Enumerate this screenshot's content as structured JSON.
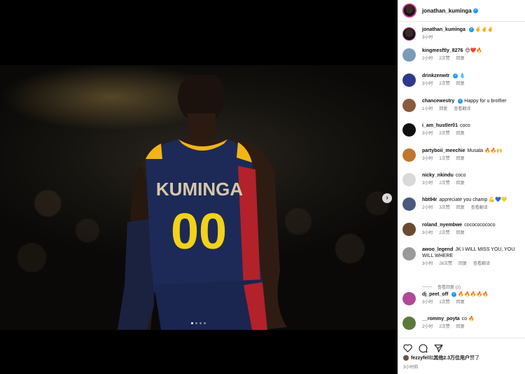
{
  "post": {
    "author": "jonathan_kuminga",
    "image_dots": 4,
    "active_dot": 0,
    "jersey": {
      "name": "KUMINGA",
      "number": "00"
    }
  },
  "caption": {
    "user": "jonathan_kuminga",
    "text": "✌️✌️✌️",
    "time": "3小时",
    "verified": true
  },
  "comments": [
    {
      "user": "kingmesftly_8276",
      "text": "😍❤️🔥",
      "time": "2小时",
      "likes": "2次赞",
      "reply": "回复",
      "translate": "",
      "verified": false,
      "avatar": "#7b9ab8"
    },
    {
      "user": "drinkzenwtr",
      "text": "💧",
      "time": "3小时",
      "likes": "2次赞",
      "reply": "回复",
      "translate": "",
      "verified": true,
      "avatar": "#2d3a8c"
    },
    {
      "user": "chancewestry",
      "text": "Happy for u brother",
      "time": "1小时",
      "likes": "",
      "reply": "回复",
      "translate": "查看翻译",
      "verified": true,
      "avatar": "#8a5a3c"
    },
    {
      "user": "i_am_hustler01",
      "text": "coco",
      "time": "3小时",
      "likes": "2次赞",
      "reply": "回复",
      "translate": "",
      "verified": false,
      "avatar": "#111111"
    },
    {
      "user": "partyboii_meechie",
      "text": "Musala 🔥🔥🙌",
      "time": "3小时",
      "likes": "1次赞",
      "reply": "回复",
      "translate": "",
      "verified": false,
      "avatar": "#c0762e"
    },
    {
      "user": "nicky_nkindu",
      "text": "coco",
      "time": "3小时",
      "likes": "2次赞",
      "reply": "回复",
      "translate": "",
      "verified": false,
      "avatar": "#d9d9d9"
    },
    {
      "user": "hbt94r",
      "text": "appreciate you champ 💪💙💛",
      "time": "2小时",
      "likes": "3次赞",
      "reply": "回复",
      "translate": "查看翻译",
      "verified": false,
      "avatar": "#4a5a7a"
    },
    {
      "user": "roland_nyembwe",
      "text": "cocococococo",
      "time": "3小时",
      "likes": "2次赞",
      "reply": "回复",
      "translate": "",
      "verified": false,
      "avatar": "#6b4a32"
    },
    {
      "user": "awoo_legend",
      "text": "JK I WILL MISS YOU, YOU WILL WHERE",
      "time": "3小时",
      "likes": "26次赞",
      "reply": "回复",
      "translate": "查看翻译",
      "verified": false,
      "avatar": "#9a9a9a"
    },
    {
      "user": "dj_peet_off",
      "text": "🔥🔥🔥🔥🔥",
      "time": "3小时",
      "likes": "1次赞",
      "reply": "回复",
      "translate": "",
      "verified": true,
      "avatar": "#b04a9a"
    },
    {
      "user": "__rommy_poyta",
      "text": "co 🔥",
      "time": "2小时",
      "likes": "2次赞",
      "reply": "回复",
      "translate": "",
      "verified": false,
      "avatar": "#5a7a3a"
    }
  ],
  "view_replies": "查看回复 (2)",
  "liked_by": {
    "user": "fezzyfel",
    "suffix": "和",
    "others": "其他2.3万位用户",
    "end": "赞了"
  },
  "post_time": "3小时前"
}
